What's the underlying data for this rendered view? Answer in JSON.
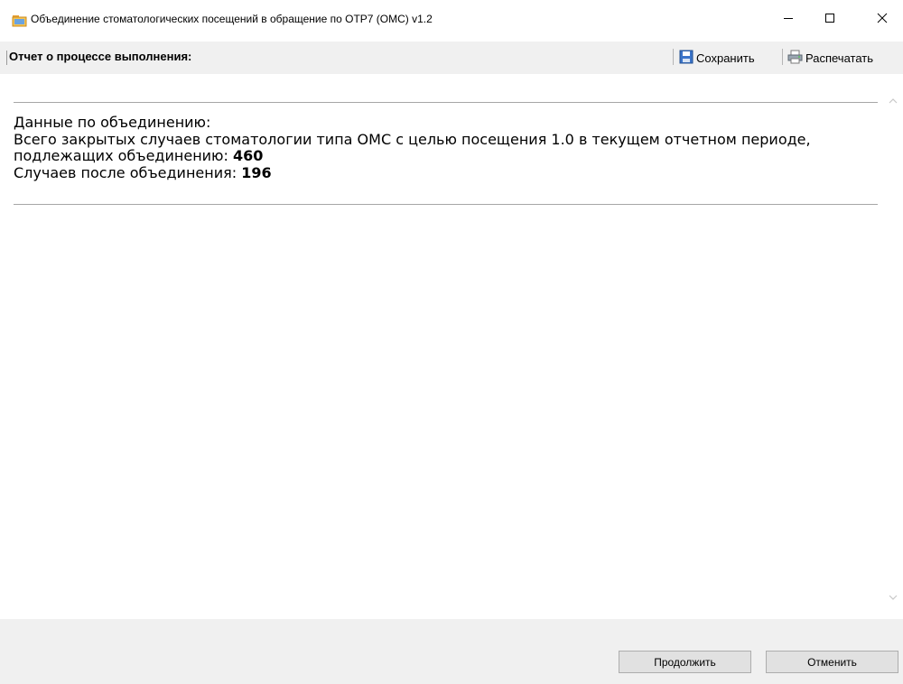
{
  "window": {
    "title": "Объединение стоматологических посещений в обращение по ОТР7 (ОМС) v1.2",
    "icon": "folder-app-icon",
    "controls": [
      "minimize-icon",
      "maximize-icon",
      "close-icon"
    ]
  },
  "toolbar": {
    "report_title": "Отчет о процессе выполнения:",
    "save_label": "Сохранить",
    "print_label": "Распечатать",
    "save_icon": "floppy-disk-icon",
    "print_icon": "printer-icon"
  },
  "report": {
    "heading": "Данные по объединению:",
    "line1_text": "Всего закрытых случаев стоматологии типа ОМС с целью посещения 1.0 в текущем отчетном периоде, подлежащих объединению: ",
    "line1_value": "460",
    "line2_text": "Случаев после объединения: ",
    "line2_value": "196"
  },
  "footer": {
    "continue_label": "Продолжить",
    "cancel_label": "Отменить"
  },
  "colors": {
    "toolbar_bg": "#f0f0f0",
    "button_bg": "#e1e1e1",
    "button_border": "#adadad"
  }
}
